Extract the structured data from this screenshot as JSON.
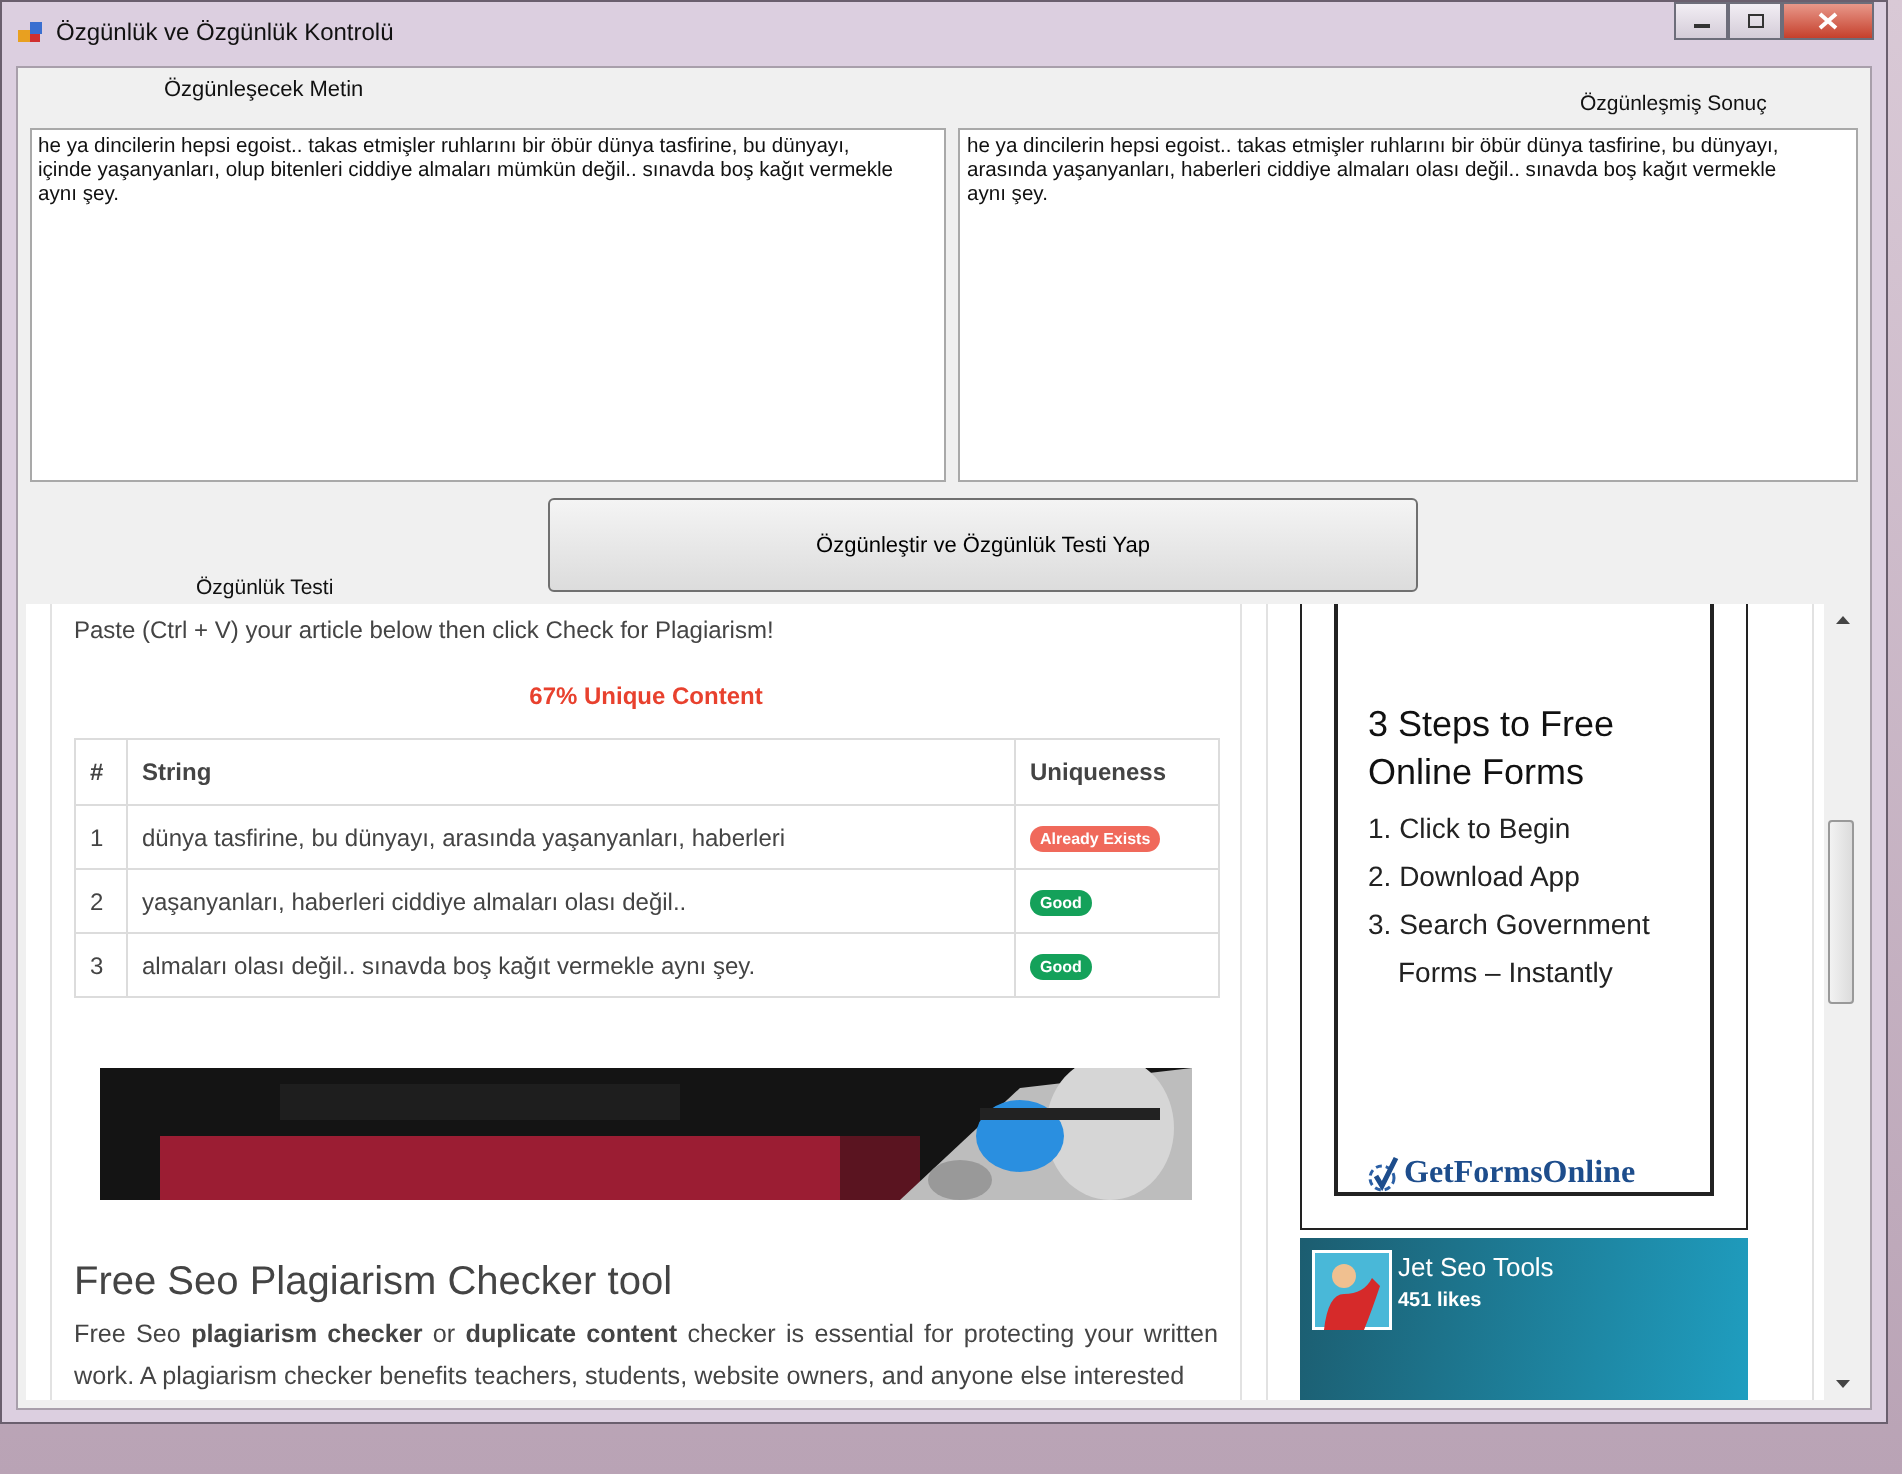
{
  "window": {
    "title": "Özgünlük ve Özgünlük Kontrolü"
  },
  "source": {
    "label": "Özgünleşecek Metin",
    "text": "he ya dincilerin hepsi egoist.. takas etmişler ruhlarını bir öbür dünya tasfirine, bu dünyayı, içinde yaşanyanları, olup bitenleri ciddiye almaları mümkün değil.. sınavda boş kağıt vermekle aynı şey."
  },
  "result": {
    "label": "Özgünleşmiş Sonuç",
    "text": "he ya dincilerin hepsi egoist.. takas etmişler ruhlarını bir öbür dünya tasfirine, bu dünyayı, arasında yaşanyanları, haberleri ciddiye almaları olası değil.. sınavda boş kağıt vermekle aynı şey."
  },
  "action_button": "Özgünleştir ve Özgünlük Testi Yap",
  "test_label": "Özgünlük Testi",
  "browser": {
    "intro": "Paste (Ctrl + V) your article below then click Check for Plagiarism!",
    "score": "67% Unique Content",
    "table": {
      "columns": [
        "#",
        "String",
        "Uniqueness"
      ],
      "rows": [
        {
          "index": "1",
          "string": "dünya tasfirine, bu dünyayı, arasında yaşanyanları, haberleri",
          "badge": "Already Exists",
          "kind": "exists"
        },
        {
          "index": "2",
          "string": "yaşanyanları, haberleri ciddiye almaları olası değil..",
          "badge": "Good",
          "kind": "good"
        },
        {
          "index": "3",
          "string": "almaları olası değil.. sınavda boş kağıt vermekle aynı şey.",
          "badge": "Good",
          "kind": "good"
        }
      ]
    },
    "article": {
      "heading": "Free Seo Plagiarism Checker tool",
      "paragraph": "Free Seo **plagiarism checker** or **duplicate content** checker is essential for protecting your written work. A plagiarism checker benefits teachers, students, website owners, and anyone else interested"
    },
    "forms_ad": {
      "title": "3 Steps to Free Online Forms",
      "steps": [
        "1. Click to Begin",
        "2. Download App",
        "3. Search Government Forms – Instantly"
      ],
      "brand": "GetFormsOnline"
    },
    "social": {
      "name": "Jet Seo Tools",
      "likes": "451 likes"
    }
  }
}
